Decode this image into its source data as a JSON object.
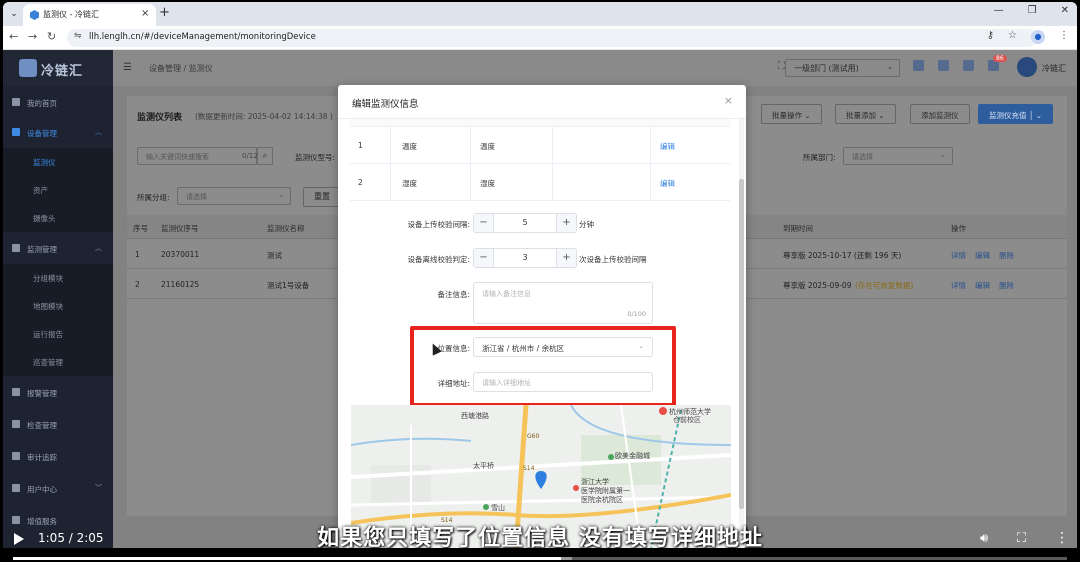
{
  "browser": {
    "tab_title": "监测仪 - 冷链汇",
    "url": "llh.lenglh.cn/#/deviceManagement/monitoringDevice"
  },
  "app": {
    "logo_text": "冷链汇",
    "breadcrumb": "设备管理 / 监测仪",
    "dept_select": "一级部门 (测试用)",
    "notification_count": "86",
    "user_name": "冷链汇"
  },
  "sidebar": {
    "items": [
      {
        "label": "我的首页"
      },
      {
        "label": "设备管理"
      },
      {
        "label": "监测仪"
      },
      {
        "label": "资产"
      },
      {
        "label": "摄像头"
      },
      {
        "label": "监测管理"
      },
      {
        "label": "分组模块"
      },
      {
        "label": "地图模块"
      },
      {
        "label": "运行报告"
      },
      {
        "label": "巡查管理"
      },
      {
        "label": "报警管理"
      },
      {
        "label": "检查管理"
      },
      {
        "label": "审计追踪"
      },
      {
        "label": "用户中心"
      },
      {
        "label": "增值服务"
      }
    ]
  },
  "list": {
    "title": "监测仪列表",
    "update_time": "(数据更新时间: 2025-04-02 14:14:38 )",
    "buttons": {
      "batch_ops": "批量操作",
      "batch_add": "批量添加",
      "add_device": "添加监测仪",
      "recharge": "监测仪充值"
    },
    "search_placeholder": "输入关键词快速搜索",
    "search_count": "0/12",
    "filter_model_label": "监测仪型号:",
    "filter_dept_label": "所属部门:",
    "filter_dept_placeholder": "请选择",
    "filter_group_label": "所属分组:",
    "filter_group_placeholder": "请选择",
    "reset": "重置",
    "columns": {
      "no": "序号",
      "serial": "监测仪序号",
      "name": "监测仪名称",
      "expire": "到期时间",
      "action": "操作"
    },
    "rows": [
      {
        "no": "1",
        "serial": "20370011",
        "name": "测试",
        "expire": "尊享版 2025-10-17 (还剩 196 天)",
        "actions": [
          "详情",
          "编辑",
          "删除"
        ]
      },
      {
        "no": "2",
        "serial": "21160125",
        "name": "测试1号设备",
        "expire": "尊享版 2025-09-09",
        "expire_note": "(存在可恢复数据)",
        "actions": [
          "详情",
          "编辑",
          "删除"
        ]
      }
    ]
  },
  "modal": {
    "title": "编辑监测仪信息",
    "table_rows": [
      {
        "no": "1",
        "a": "温度",
        "b": "温度",
        "action": "编辑"
      },
      {
        "no": "2",
        "a": "湿度",
        "b": "湿度",
        "action": "编辑"
      }
    ],
    "upload_interval_label": "设备上传校验间隔:",
    "upload_interval_value": "5",
    "upload_interval_unit": "分钟",
    "offline_label": "设备离线校验判定:",
    "offline_value": "3",
    "offline_unit": "次设备上传校验间隔",
    "remark_label": "备注信息:",
    "remark_placeholder": "请输入备注信息",
    "remark_count": "0/100",
    "location_label": "位置信息:",
    "location_value": "浙江省 / 杭州市 / 余杭区",
    "address_label": "详细地址:",
    "address_placeholder": "请输入详细地址",
    "map_labels": {
      "university": "杭州师范大学",
      "university2": "仓前校区",
      "west_station": "西塘港路",
      "taiping": "太平桥",
      "ouchuang": "欧美金融城",
      "hospital1": "浙江大学",
      "hospital2": "医学院附属第一",
      "hospital3": "医院余杭院区",
      "xueshan": "雪山",
      "hwy_a": "G60",
      "hwy_b": "S14",
      "hwy_c": "S14"
    }
  },
  "video": {
    "subtitle": "如果您只填写了位置信息 没有填写详细地址",
    "time": "1:05 / 2:05",
    "progress": 0.52,
    "buffered": 0.53
  },
  "colors": {
    "highlight": "#e8251c",
    "accent": "#2f7fe0"
  }
}
